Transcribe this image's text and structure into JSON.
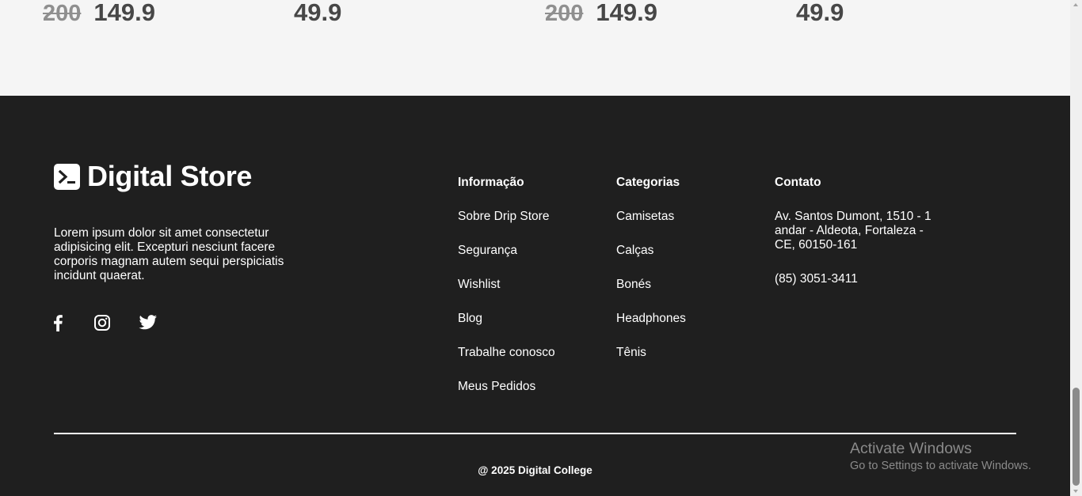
{
  "prices": [
    {
      "old": "200",
      "new": "149.9"
    },
    {
      "old": "",
      "new": "49.9"
    },
    {
      "old": "200",
      "new": "149.9"
    },
    {
      "old": "",
      "new": "49.9"
    }
  ],
  "footer": {
    "brand": "Digital Store",
    "about": "Lorem ipsum dolor sit amet consectetur adipisicing elit. Excepturi nesciunt facere corporis magnam autem sequi perspiciatis incidunt quaerat.",
    "social": [
      "facebook-icon",
      "instagram-icon",
      "twitter-icon"
    ],
    "info": {
      "title": "Informação",
      "items": [
        "Sobre Drip Store",
        "Segurança",
        "Wishlist",
        "Blog",
        "Trabalhe conosco",
        "Meus Pedidos"
      ]
    },
    "categories": {
      "title": "Categorias",
      "items": [
        "Camisetas",
        "Calças",
        "Bonés",
        "Headphones",
        "Tênis"
      ]
    },
    "contact": {
      "title": "Contato",
      "address": "Av. Santos Dumont, 1510 - 1 andar - Aldeota, Fortaleza - CE, 60150-161",
      "phone": "(85) 3051-3411"
    },
    "copyright": "@ 2025 Digital College"
  },
  "watermark": {
    "title": "Activate Windows",
    "subtitle": "Go to Settings to activate Windows."
  },
  "colors": {
    "footer_bg": "#1f1f1f",
    "page_bg": "#f5f5f5",
    "old_price": "#8f8f8f",
    "new_price": "#474747"
  }
}
